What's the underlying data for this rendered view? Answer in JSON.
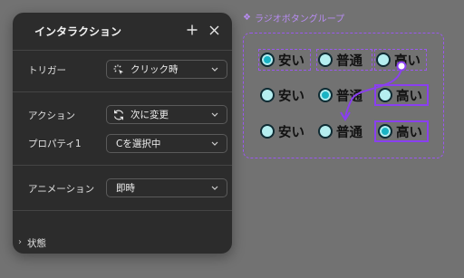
{
  "panel": {
    "title": "インタラクション",
    "rows": {
      "trigger": {
        "label": "トリガー",
        "value": "クリック時",
        "icon": "click-icon"
      },
      "action": {
        "label": "アクション",
        "value": "次に変更",
        "icon": "change-icon"
      },
      "property": {
        "label": "プロパティ1",
        "value": "Cを選択中"
      },
      "animation": {
        "label": "アニメーション",
        "value": "即時"
      }
    },
    "state": {
      "label": "状態"
    }
  },
  "group": {
    "label": "ラジオボタングループ",
    "icon": "component-instance-icon",
    "rows": [
      {
        "options": [
          "安い",
          "普通",
          "高い"
        ],
        "selected": 0
      },
      {
        "options": [
          "安い",
          "普通",
          "高い"
        ],
        "selected": 1
      },
      {
        "options": [
          "安い",
          "普通",
          "高い"
        ],
        "selected": 2
      }
    ]
  },
  "colors": {
    "accent": "#9b57f0",
    "radio_fill": "#b5eef0",
    "radio_selected": "#19b3c4"
  }
}
